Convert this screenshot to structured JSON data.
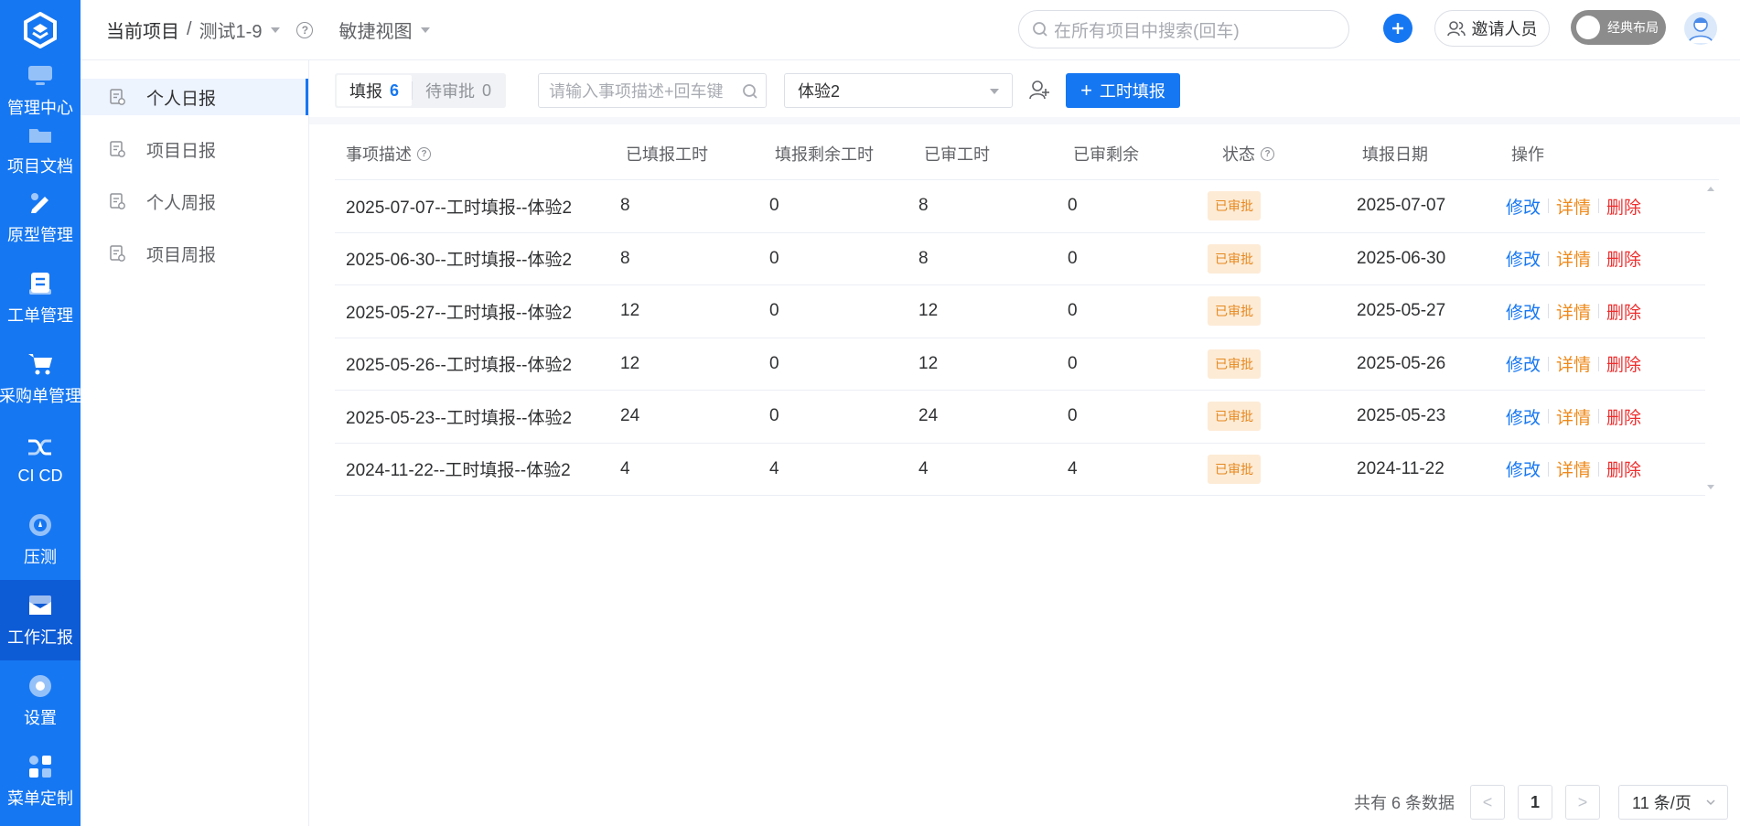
{
  "header": {
    "breadcrumb_root": "当前项目",
    "breadcrumb_sep": "/",
    "project_name": "测试1-9",
    "view_name": "敏捷视图",
    "search_placeholder": "在所有项目中搜索(回车)",
    "invite_label": "邀请人员",
    "layout_toggle_label": "经典布局"
  },
  "rail": {
    "items": [
      {
        "label": "管理中心",
        "icon": "monitor-icon"
      },
      {
        "label": "项目文档",
        "icon": "folder-icon"
      },
      {
        "label": "原型管理",
        "icon": "prototype-icon"
      },
      {
        "label": "工单管理",
        "icon": "ticket-icon"
      },
      {
        "label": "采购单管理",
        "icon": "cart-icon"
      },
      {
        "label": "CI CD",
        "icon": "cicd-icon"
      },
      {
        "label": "压测",
        "icon": "gauge-icon"
      },
      {
        "label": "工作汇报",
        "icon": "mail-icon"
      },
      {
        "label": "设置",
        "icon": "settings-icon"
      },
      {
        "label": "菜单定制",
        "icon": "grid-icon"
      }
    ],
    "active_index": 7
  },
  "subnav": {
    "items": [
      {
        "label": "个人日报"
      },
      {
        "label": "项目日报"
      },
      {
        "label": "个人周报"
      },
      {
        "label": "项目周报"
      }
    ],
    "active_index": 0
  },
  "toolbar": {
    "tab_filled_label": "填报",
    "tab_filled_count": "6",
    "tab_pending_label": "待审批",
    "tab_pending_count": "0",
    "keyword_placeholder": "请输入事项描述+回车键",
    "selected_user": "体验2",
    "add_button_label": "工时填报",
    "add_button_icon": "+"
  },
  "table": {
    "columns": [
      "事项描述",
      "已填报工时",
      "填报剩余工时",
      "已审工时",
      "已审剩余",
      "状态",
      "填报日期",
      "操作"
    ],
    "rows": [
      {
        "desc": "2025-07-07--工时填报--体验2",
        "filled": "8",
        "fill_remain": "0",
        "approved": "8",
        "approve_remain": "0",
        "status": "已审批",
        "date": "2025-07-07"
      },
      {
        "desc": "2025-06-30--工时填报--体验2",
        "filled": "8",
        "fill_remain": "0",
        "approved": "8",
        "approve_remain": "0",
        "status": "已审批",
        "date": "2025-06-30"
      },
      {
        "desc": "2025-05-27--工时填报--体验2",
        "filled": "12",
        "fill_remain": "0",
        "approved": "12",
        "approve_remain": "0",
        "status": "已审批",
        "date": "2025-05-27"
      },
      {
        "desc": "2025-05-26--工时填报--体验2",
        "filled": "12",
        "fill_remain": "0",
        "approved": "12",
        "approve_remain": "0",
        "status": "已审批",
        "date": "2025-05-26"
      },
      {
        "desc": "2025-05-23--工时填报--体验2",
        "filled": "24",
        "fill_remain": "0",
        "approved": "24",
        "approve_remain": "0",
        "status": "已审批",
        "date": "2025-05-23"
      },
      {
        "desc": "2024-11-22--工时填报--体验2",
        "filled": "4",
        "fill_remain": "4",
        "approved": "4",
        "approve_remain": "4",
        "status": "已审批",
        "date": "2024-11-22"
      }
    ],
    "actions": {
      "edit": "修改",
      "detail": "详情",
      "delete": "删除"
    }
  },
  "pagination": {
    "total_text": "共有 6 条数据",
    "prev": "<",
    "current_page": "1",
    "next": ">",
    "page_size": "11 条/页"
  },
  "colors": {
    "primary": "#1677f2",
    "status_bg": "#fdebd6",
    "status_text": "#e6891f",
    "detail": "#ef8a1b",
    "delete": "#ee2e2e"
  }
}
